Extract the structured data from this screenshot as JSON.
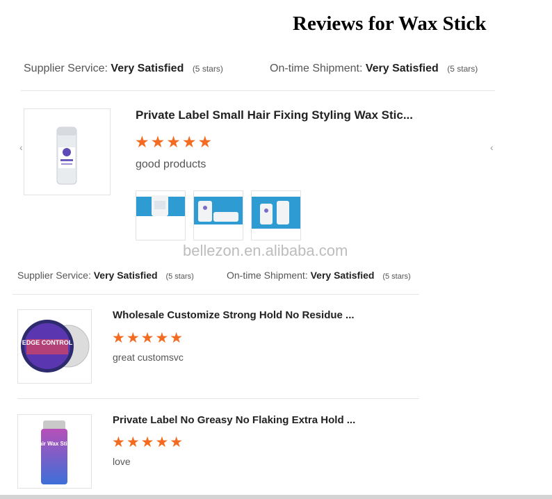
{
  "page_title": "Reviews for Wax Stick",
  "watermark": "bellezon.en.alibaba.com",
  "colors": {
    "star": "#f36b21",
    "divider": "#e5e5e5"
  },
  "section1": {
    "supplier_label": "Supplier Service:",
    "supplier_value": "Very Satisfied",
    "supplier_stars": "(5 stars)",
    "shipment_label": "On-time Shipment:",
    "shipment_value": "Very Satisfied",
    "shipment_stars": "(5 stars)",
    "review": {
      "title": "Private Label Small Hair Fixing Styling Wax Stic...",
      "rating": 5,
      "stars": "★★★★★",
      "comment": "good products",
      "photos": [
        "review-photo-1",
        "review-photo-2",
        "review-photo-3"
      ]
    },
    "prev_arrow": "‹",
    "next_arrow": "‹"
  },
  "section2": {
    "supplier_label": "Supplier Service:",
    "supplier_value": "Very Satisfied",
    "supplier_stars": "(5 stars)",
    "shipment_label": "On-time Shipment:",
    "shipment_value": "Very Satisfied",
    "shipment_stars": "(5 stars)",
    "reviews": [
      {
        "title": "Wholesale Customize Strong Hold No Residue ...",
        "rating": 5,
        "stars": "★★★★★",
        "comment": "great customsvc",
        "image_text": "EDGE CONTROL"
      },
      {
        "title": "Private Label No Greasy No Flaking Extra Hold ...",
        "rating": 5,
        "stars": "★★★★★",
        "comment": "love",
        "image_text": "Hair Wax Stick"
      }
    ]
  }
}
